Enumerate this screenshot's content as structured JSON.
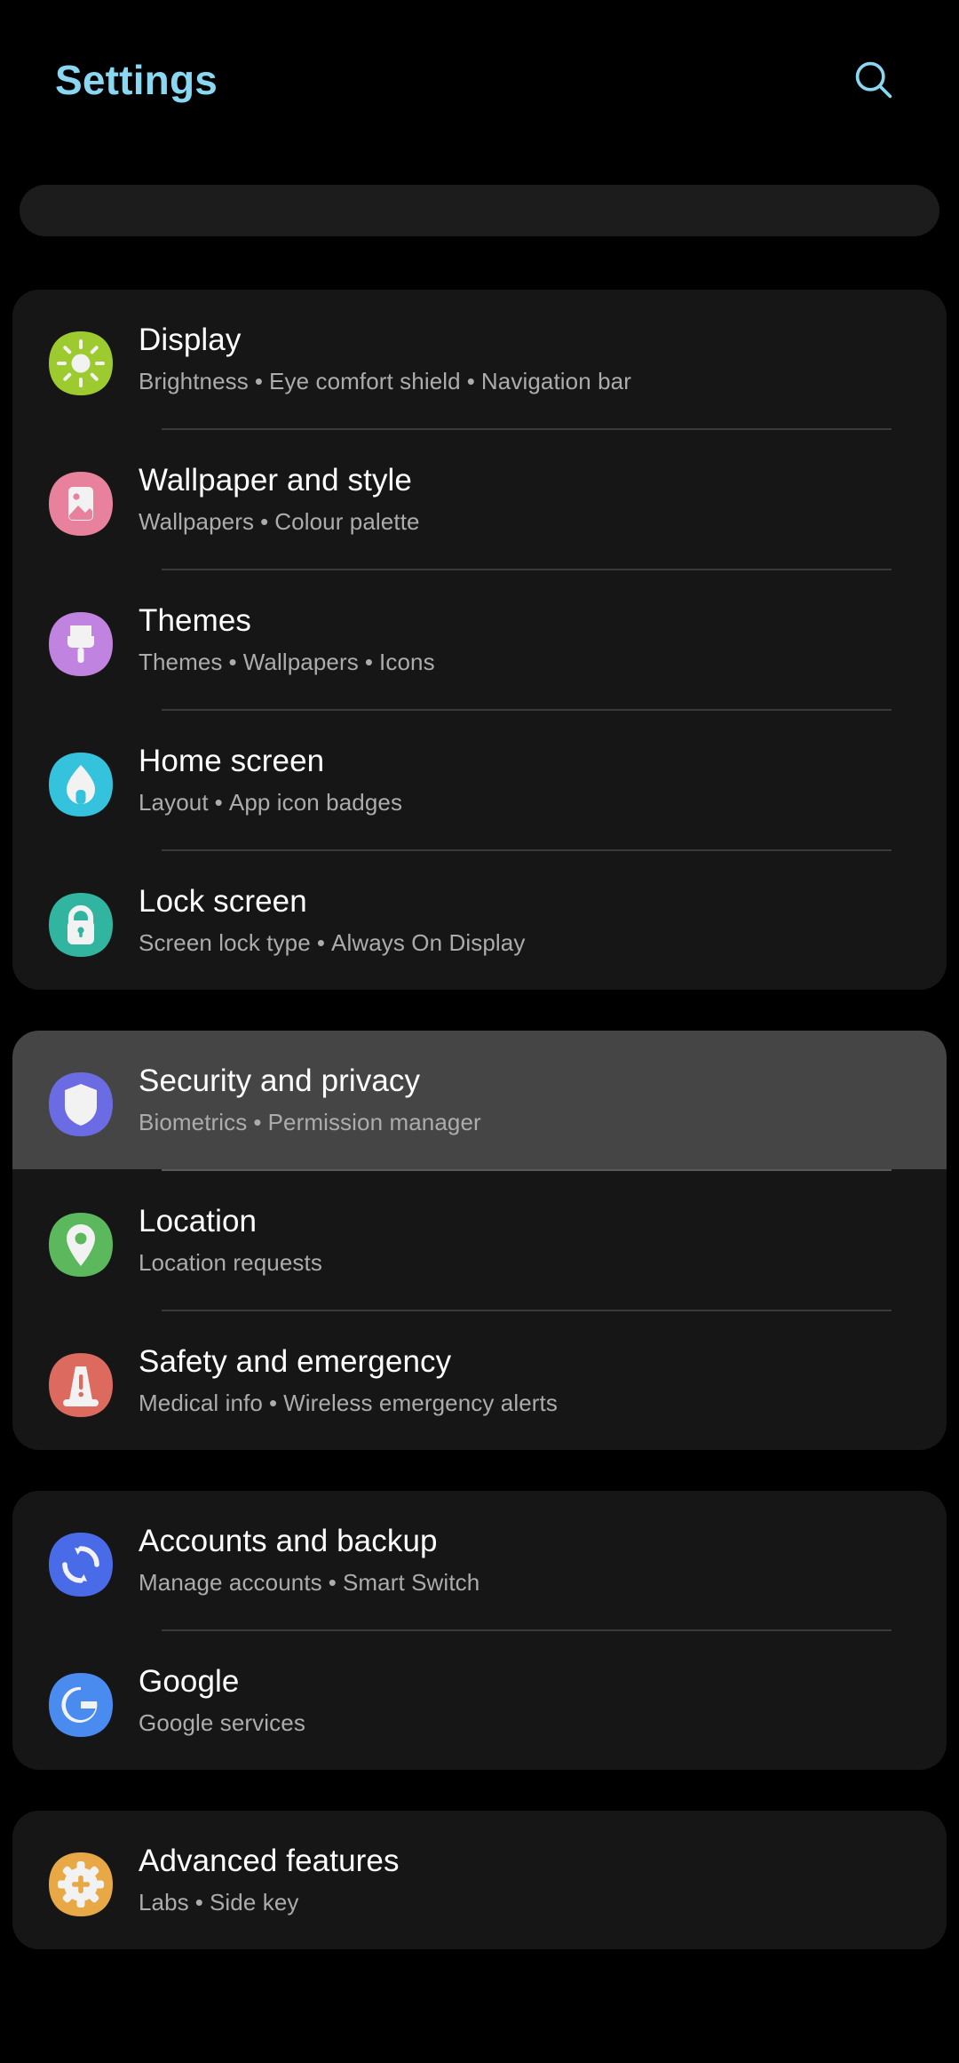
{
  "header": {
    "title": "Settings",
    "title_color": "#8AD7F2",
    "search_icon": "search-icon"
  },
  "search_bar": {
    "value": "",
    "placeholder": ""
  },
  "groups": [
    {
      "id": "personalization",
      "selected": false,
      "items": [
        {
          "key": "display",
          "title": "Display",
          "subtitle_parts": [
            "Brightness",
            "Eye comfort shield",
            "Navigation bar"
          ],
          "subtitle": "Brightness  •  Eye comfort shield  •  Navigation bar",
          "icon": "sun-icon",
          "icon_color": "#9DCB2F"
        },
        {
          "key": "wallpaper-and-style",
          "title": "Wallpaper and style",
          "subtitle_parts": [
            "Wallpapers",
            "Colour palette"
          ],
          "subtitle": "Wallpapers  •  Colour palette",
          "icon": "photo-icon",
          "icon_color": "#E8829C"
        },
        {
          "key": "themes",
          "title": "Themes",
          "subtitle_parts": [
            "Themes",
            "Wallpapers",
            "Icons"
          ],
          "subtitle": "Themes  •  Wallpapers  •  Icons",
          "icon": "paintbrush-icon",
          "icon_color": "#C183E0"
        },
        {
          "key": "home-screen",
          "title": "Home screen",
          "subtitle_parts": [
            "Layout",
            "App icon badges"
          ],
          "subtitle": "Layout  •  App icon badges",
          "icon": "house-icon",
          "icon_color": "#35C2DC"
        },
        {
          "key": "lock-screen",
          "title": "Lock screen",
          "subtitle_parts": [
            "Screen lock type",
            "Always On Display"
          ],
          "subtitle": "Screen lock type  •  Always On Display",
          "icon": "lock-icon",
          "icon_color": "#32B5A0"
        }
      ]
    },
    {
      "id": "security-location",
      "selected": true,
      "items": [
        {
          "key": "security-and-privacy",
          "title": "Security and privacy",
          "subtitle_parts": [
            "Biometrics",
            "Permission manager"
          ],
          "subtitle": "Biometrics  •  Permission manager",
          "icon": "shield-icon",
          "icon_color": "#6B6BE4",
          "highlighted": true
        },
        {
          "key": "location",
          "title": "Location",
          "subtitle_parts": [
            "Location requests"
          ],
          "subtitle": "Location requests",
          "icon": "map-pin-icon",
          "icon_color": "#5CB85C"
        },
        {
          "key": "safety-and-emergency",
          "title": "Safety and emergency",
          "subtitle_parts": [
            "Medical info",
            "Wireless emergency alerts"
          ],
          "subtitle": "Medical info  •  Wireless emergency alerts",
          "icon": "emergency-beacon-icon",
          "icon_color": "#DC6A5E"
        }
      ]
    },
    {
      "id": "accounts",
      "selected": false,
      "items": [
        {
          "key": "accounts-and-backup",
          "title": "Accounts and backup",
          "subtitle_parts": [
            "Manage accounts",
            "Smart Switch"
          ],
          "subtitle": "Manage accounts  •  Smart Switch",
          "icon": "sync-icon",
          "icon_color": "#4A6BE8"
        },
        {
          "key": "google",
          "title": "Google",
          "subtitle_parts": [
            "Google services"
          ],
          "subtitle": "Google services",
          "icon": "google-g-icon",
          "icon_color": "#4A8BF0"
        }
      ]
    },
    {
      "id": "advanced",
      "selected": false,
      "items": [
        {
          "key": "advanced-features",
          "title": "Advanced features",
          "subtitle_parts": [
            "Labs",
            "Side key"
          ],
          "subtitle": "Labs  •  Side key",
          "icon": "gear-plus-icon",
          "icon_color": "#E8A845"
        }
      ]
    }
  ],
  "colors": {
    "page_background": "#000000",
    "card_background": "#161616",
    "selected_background": "#454545",
    "title_text": "#FFFFFF",
    "subtitle_text": "#ACACAC",
    "divider": "#3A3A3A",
    "accent": "#8AD7F2"
  }
}
